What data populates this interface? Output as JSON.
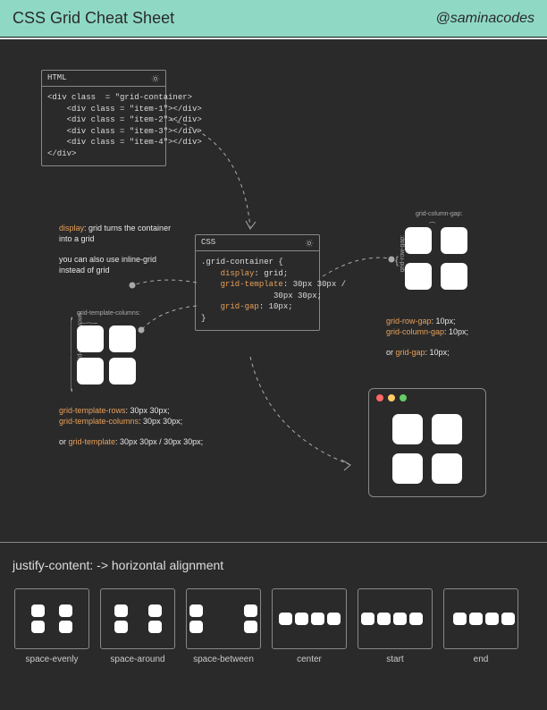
{
  "header": {
    "title": "CSS Grid Cheat Sheet",
    "handle": "@saminacodes"
  },
  "html_box": {
    "label": "HTML",
    "line1": "<div class  = \"grid-container>",
    "line2": "    <div class = \"item-1\"></div>",
    "line3": "    <div class = \"item-2\"></div>",
    "line4": "    <div class = \"item-3\"></div>",
    "line5": "    <div class = \"item-4\"></div>",
    "line6": "</div>"
  },
  "css_box": {
    "label": "CSS",
    "l1": ".grid-container {",
    "l2p": "display",
    "l2v": ": grid;",
    "l3p": "grid-template",
    "l3v": ": 30px 30px /",
    "l3v2": "30px 30px;",
    "l4p": "grid-gap",
    "l4v": ": 10px;",
    "l5": "}"
  },
  "note_display": {
    "l1a": "display",
    "l1b": ": grid turns the container into a grid",
    "l2": "you can also use inline-grid instead of grid"
  },
  "labels": {
    "gtc": "grid-template-columns:",
    "gtr": "grid-template-rows:",
    "gcg": "grid-column-gap:",
    "grg": "grid-row-gap:"
  },
  "note_template": {
    "l1p": "grid-template-rows",
    "l1v": ": 30px 30px;",
    "l2p": "grid-template-columns",
    "l2v": ": 30px 30px;",
    "l3a": "or ",
    "l3p": "grid-template",
    "l3v": ": 30px 30px / 30px 30px;"
  },
  "note_gap": {
    "l1p": "grid-row-gap",
    "l1v": ": 10px;",
    "l2p": "grid-column-gap",
    "l2v": ": 10px;",
    "l3a": "or ",
    "l3p": "grid-gap",
    "l3v": ": 10px;"
  },
  "section": {
    "title": "justify-content: -> horizontal alignment"
  },
  "jc": [
    "space-evenly",
    "space-around",
    "space-between",
    "center",
    "start",
    "end"
  ]
}
